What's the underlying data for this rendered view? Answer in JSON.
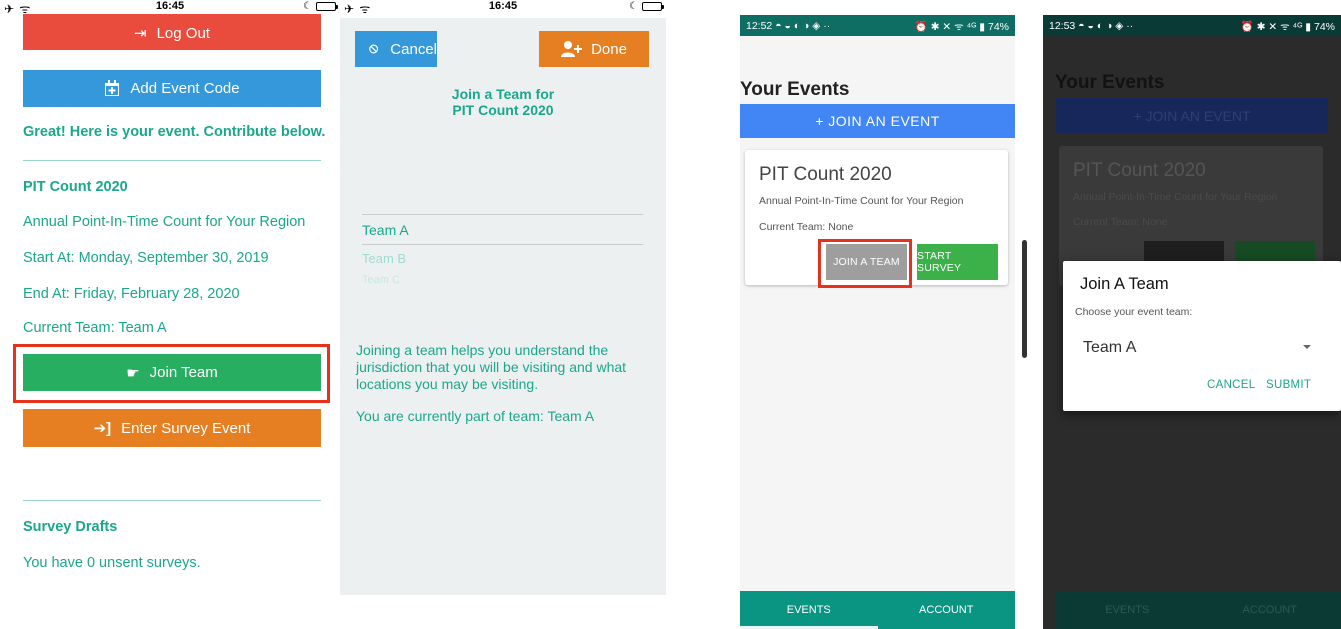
{
  "screen1": {
    "status_time": "16:45",
    "logout_label": "Log Out",
    "add_event_code_label": "Add Event Code",
    "message": "Great! Here is your event. Contribute below.",
    "event_name": "PIT Count 2020",
    "event_description": "Annual Point-In-Time Count for Your Region",
    "start_at": "Start At: Monday, September 30, 2019",
    "end_at": "End At: Friday, February 28, 2020",
    "current_team": "Current Team: Team A",
    "join_team_label": "Join Team",
    "enter_survey_label": "Enter Survey Event",
    "drafts_title": "Survey Drafts",
    "drafts_text": "You have 0 unsent surveys."
  },
  "screen2": {
    "status_time": "16:45",
    "cancel_label": "Cancel",
    "done_label": "Done",
    "title_line1": "Join a Team for",
    "title_line2": "PIT Count 2020",
    "teams": [
      "Team A",
      "Team B",
      "Team C"
    ],
    "help_text": "Joining a team helps you understand the jurisdiction that you will be visiting and what locations you may be visiting.",
    "current_team_text": "You are currently part of team: Team A"
  },
  "screen3": {
    "status_time": "12:52",
    "status_icons_left": "◓ ◒ ◐ ◑ ◈ ··",
    "status_right": "⏰ ✱ ✕ ᯤ ⁴ᴳ ▮ 74%",
    "page_title": "Your Events",
    "join_event_label": "+ JOIN AN EVENT",
    "card_title": "PIT Count 2020",
    "card_description": "Annual Point-In-Time Count for Your Region",
    "card_team": "Current Team: None",
    "join_team_label": "JOIN A TEAM",
    "start_survey_label": "START SURVEY",
    "tab_events": "EVENTS",
    "tab_account": "ACCOUNT"
  },
  "screen4": {
    "status_time": "12:53",
    "status_icons_left": "◓ ◒ ◐ ◑ ◈ ··",
    "status_right": "⏰ ✱ ✕ ᯤ ⁴ᴳ ▮ 74%",
    "page_title": "Your Events",
    "join_event_label": "+ JOIN AN EVENT",
    "card_title": "PIT Count 2020",
    "card_description": "Annual Point-In-Time Count for Your Region",
    "card_team": "Current Team: None",
    "dialog_title": "Join A Team",
    "dialog_subtitle": "Choose your event team:",
    "dialog_selected": "Team A",
    "dialog_cancel": "CANCEL",
    "dialog_submit": "SUBMIT",
    "tab_events": "EVENTS",
    "tab_account": "ACCOUNT"
  },
  "colors": {
    "teal": "#1aa78c",
    "red": "#e94c3d",
    "blue": "#3498db",
    "green": "#27ae60",
    "orange": "#e67e22",
    "highlight": "#e8311a",
    "android_blue": "#4285f4",
    "android_teal": "#0a9482"
  }
}
